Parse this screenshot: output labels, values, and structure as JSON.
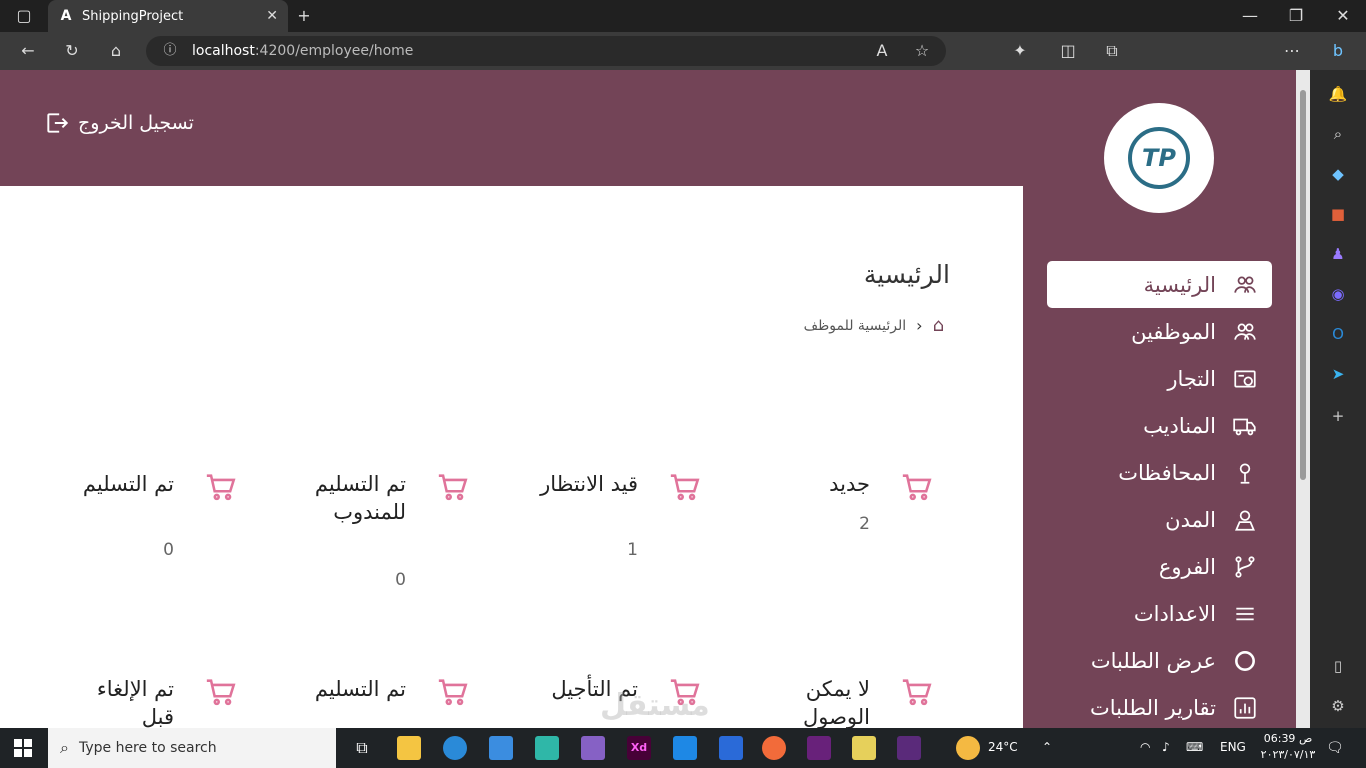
{
  "browser": {
    "tab_title": "ShippingProject",
    "url_host": "localhost",
    "url_path": ":4200/employee/home"
  },
  "header": {
    "logout_label": "تسجيل الخروج",
    "logo_text": "TP"
  },
  "sidebar": {
    "items": [
      {
        "label": "الرئيسية",
        "icon": "users-icon",
        "active": true
      },
      {
        "label": "الموظفين",
        "icon": "users-icon",
        "active": false
      },
      {
        "label": "التجار",
        "icon": "merchant-icon",
        "active": false
      },
      {
        "label": "المناديب",
        "icon": "truck-icon",
        "active": false
      },
      {
        "label": "المحافظات",
        "icon": "pin-icon",
        "active": false
      },
      {
        "label": "المدن",
        "icon": "location-icon",
        "active": false
      },
      {
        "label": "الفروع",
        "icon": "branch-icon",
        "active": false
      },
      {
        "label": "الاعدادات",
        "icon": "menu-icon",
        "active": false
      },
      {
        "label": "عرض الطلبات",
        "icon": "circle-icon",
        "active": false
      },
      {
        "label": "تقارير الطلبات",
        "icon": "report-icon",
        "active": false
      }
    ]
  },
  "main": {
    "title": "الرئيسية",
    "breadcrumb": "الرئيسية للموظف",
    "cards": [
      {
        "name": "جديد",
        "count": "2"
      },
      {
        "name": "قيد الانتظار",
        "count": "1"
      },
      {
        "name": "تم التسليم للمندوب",
        "count": "0"
      },
      {
        "name": "تم التسليم",
        "count": "0"
      },
      {
        "name": "لا يمكن الوصول",
        "count": ""
      },
      {
        "name": "تم التأجيل",
        "count": ""
      },
      {
        "name": "تم التسليم",
        "count": ""
      },
      {
        "name": "تم الإلغاء قبل",
        "count": ""
      }
    ]
  },
  "taskbar": {
    "search_placeholder": "Type here to search",
    "weather": "24°C",
    "language": "ENG",
    "time": "06:39 ص",
    "date": "٢٠٢٣/٠٧/١٣"
  },
  "watermark": "مستقل",
  "colors": {
    "brand": "#734457",
    "cart": "#e0739a"
  }
}
